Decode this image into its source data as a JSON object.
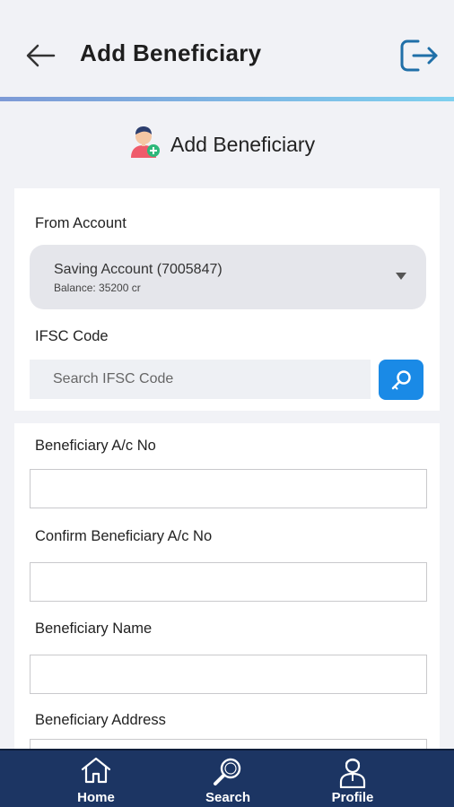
{
  "header": {
    "title": "Add Beneficiary",
    "back_icon": "arrow-left-icon",
    "logout_icon": "logout-icon",
    "accent_gradient": [
      "#7d9ad6",
      "#7ed0ef"
    ]
  },
  "section": {
    "title": "Add Beneficiary",
    "icon": "user-add-icon"
  },
  "from_account": {
    "label": "From Account",
    "selected_name": "Saving Account (7005847)",
    "selected_balance": "Balance: 35200 cr"
  },
  "ifsc": {
    "label": "IFSC Code",
    "placeholder": "Search IFSC Code",
    "value": "",
    "button_icon": "search-key-icon",
    "button_color": "#1a8ae6"
  },
  "fields": {
    "acc_no": {
      "label": "Beneficiary A/c No",
      "value": ""
    },
    "confirm_acc_no": {
      "label": "Confirm Beneficiary A/c No",
      "value": ""
    },
    "name": {
      "label": "Beneficiary Name",
      "value": ""
    },
    "address": {
      "label": "Beneficiary Address",
      "value": ""
    }
  },
  "bottom_nav": {
    "background": "#1c3563",
    "items": [
      {
        "label": "Home",
        "icon": "home-icon"
      },
      {
        "label": "Search",
        "icon": "search-icon"
      },
      {
        "label": "Profile",
        "icon": "profile-icon"
      }
    ]
  }
}
